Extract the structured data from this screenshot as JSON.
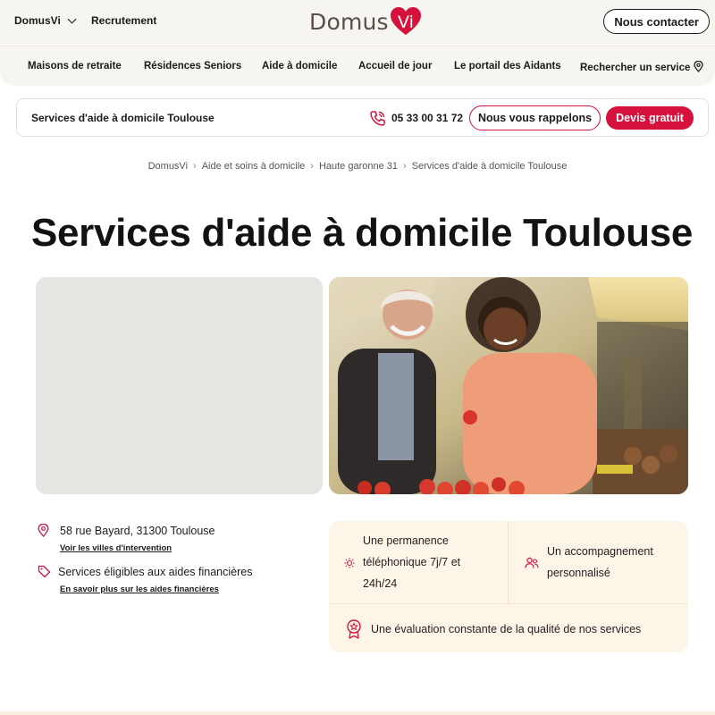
{
  "header": {
    "brand_select": "DomusVi",
    "recrutement": "Recrutement",
    "logo_text": "Domus",
    "logo_heart_letters": "Vi",
    "contact_button": "Nous contacter"
  },
  "nav": {
    "items": [
      {
        "label": "Maisons de retraite"
      },
      {
        "label": "Résidences Seniors"
      },
      {
        "label": "Aide à domicile"
      },
      {
        "label": "Accueil de jour"
      },
      {
        "label": "Le portail des Aidants"
      },
      {
        "label": "Rechercher un service"
      }
    ]
  },
  "service_bar": {
    "title": "Services d'aide à domicile Toulouse",
    "phone": "05 33 00 31 72",
    "callback_button": "Nous vous rappelons",
    "quote_button": "Devis gratuit"
  },
  "breadcrumb": [
    "DomusVi",
    "Aide et soins à domicile",
    "Haute garonne 31",
    "Services d'aide à domicile Toulouse"
  ],
  "page_title": "Services d'aide à domicile Toulouse",
  "address": {
    "line": "58 rue Bayard, 31300 Toulouse",
    "link": "Voir les villes d'intervention",
    "eligibility": "Services éligibles aux aides financières",
    "eligibility_link": "En savoir plus sur les aides financières"
  },
  "features": {
    "items": [
      {
        "lines": [
          "Une permanence",
          "téléphonique 7j/7 et",
          "24h/24"
        ],
        "icon": "sun-icon"
      },
      {
        "lines": [
          "Un accompagnement",
          "personnalisé"
        ],
        "icon": "people-icon"
      },
      {
        "lines": [
          "Une évaluation constante de la qualité de nos services"
        ],
        "icon": "award-icon"
      }
    ]
  },
  "colors": {
    "accent": "#d6123c",
    "header_bg": "#f7f5f0",
    "feature_bg": "#fdf5e8",
    "map_bg": "#e6e5e2"
  }
}
